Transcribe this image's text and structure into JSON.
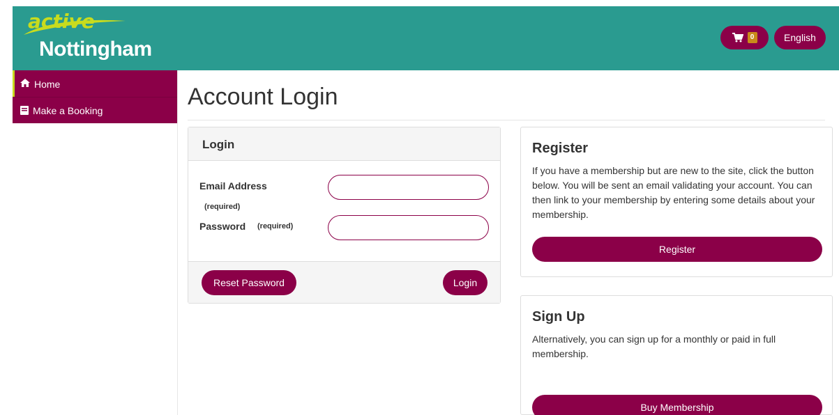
{
  "brand": {
    "logo_top": "active",
    "logo_bottom": "Nottingham",
    "primary_color": "#2a9b90",
    "accent_color": "#8b0048",
    "highlight_color": "#c8dc1e"
  },
  "header": {
    "cart_icon": "shopping-cart-icon",
    "cart_count": "0",
    "language_label": "English"
  },
  "sidebar": {
    "items": [
      {
        "label": "Home",
        "icon": "home-icon"
      },
      {
        "label": "Make a Booking",
        "icon": "book-icon"
      }
    ]
  },
  "page": {
    "title": "Account Login"
  },
  "login": {
    "heading": "Login",
    "email_label": "Email Address",
    "email_required": "(required)",
    "email_value": "",
    "password_label": "Password",
    "password_required": "(required)",
    "password_value": "",
    "reset_label": "Reset Password",
    "login_label": "Login"
  },
  "register": {
    "title": "Register",
    "text": "If you have a membership but are new to the site, click the button below. You will be sent an email validating your account. You can then link to your membership by entering some details about your membership.",
    "button_label": "Register"
  },
  "signup": {
    "title": "Sign Up",
    "text": "Alternatively, you can sign up for a monthly or paid in full membership.",
    "button_label": "Buy Membership"
  }
}
